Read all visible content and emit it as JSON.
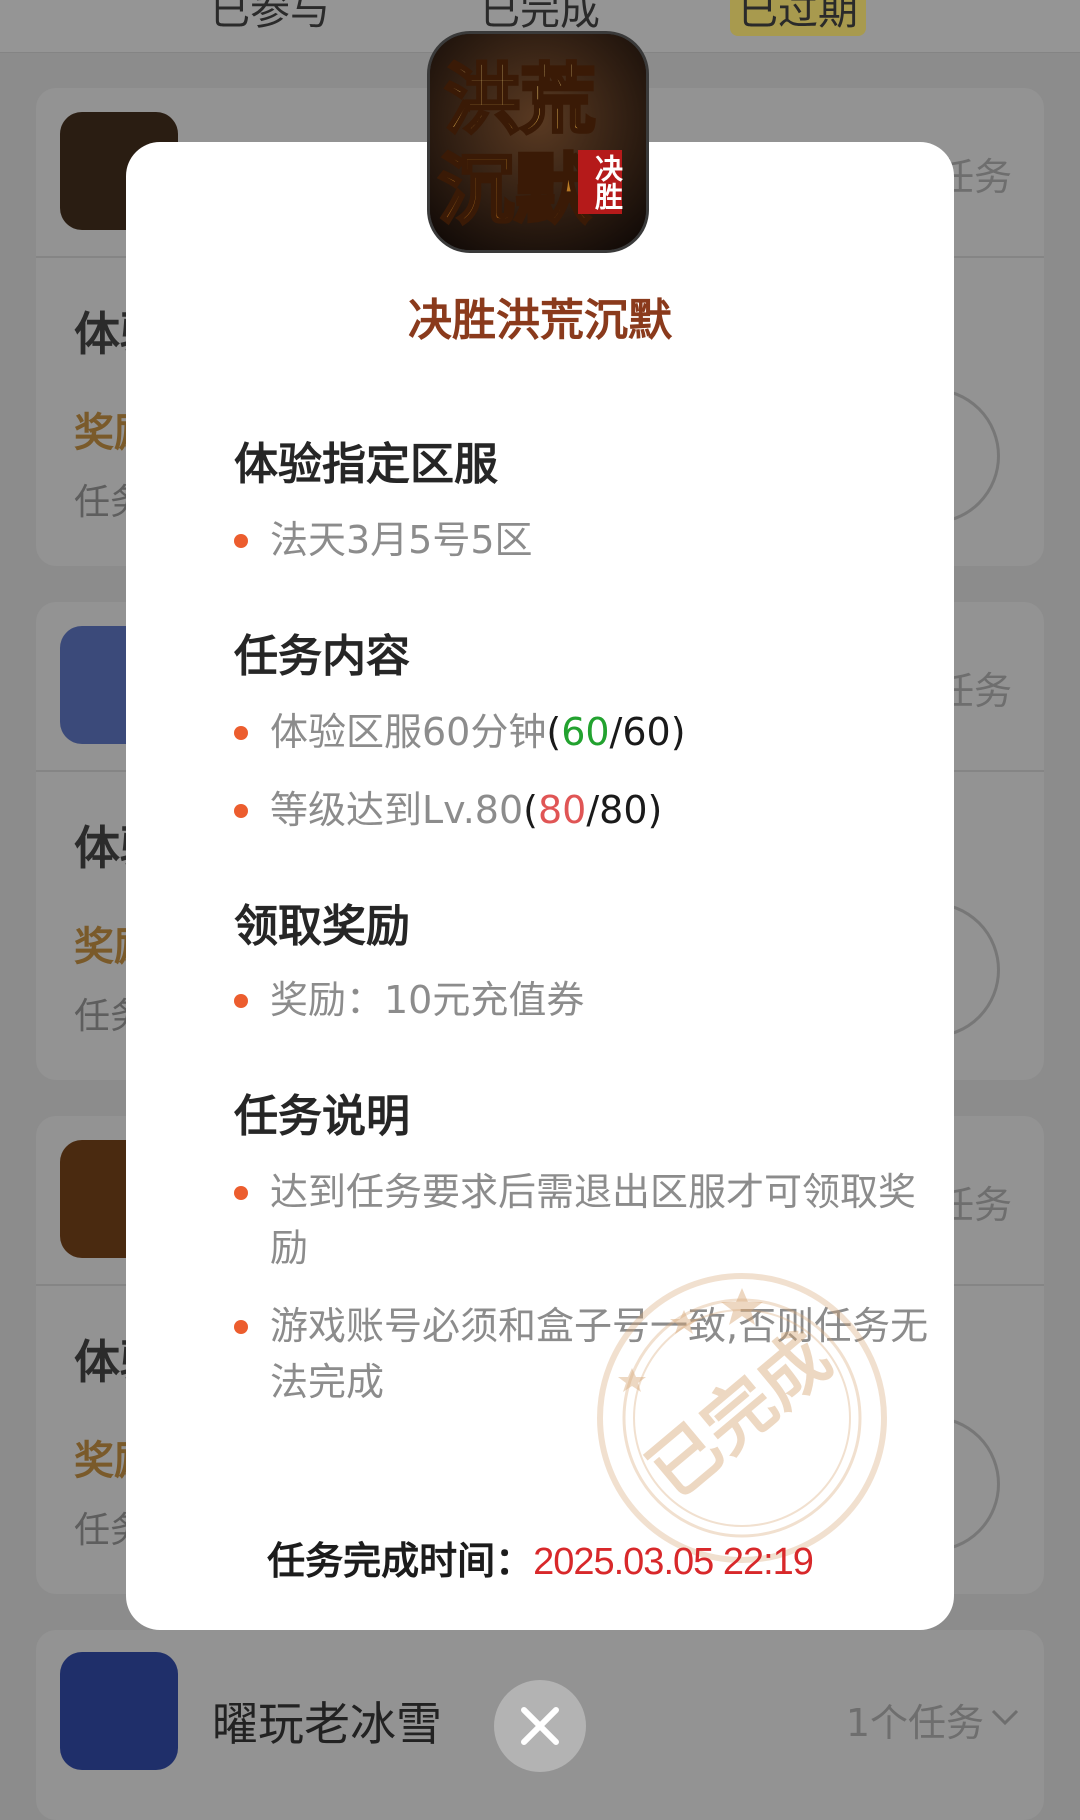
{
  "background": {
    "tabs": [
      "已参与",
      "已完成",
      "已过期"
    ],
    "cards": [
      {
        "count": "任务",
        "task_title": "体验",
        "reward": "奖励",
        "info": "任务"
      },
      {
        "count": "任务",
        "task_title": "体验",
        "reward": "奖励",
        "info": "任务"
      },
      {
        "count": "任务",
        "task_title": "体验",
        "reward": "奖励",
        "info": "任务"
      }
    ],
    "bottom_card": {
      "name": "曜玩老冰雪",
      "count": "1个任务"
    }
  },
  "modal": {
    "icon_text_main": "洪荒沉默",
    "icon_text_badge": "决胜",
    "title": "决胜洪荒沉默",
    "sections": [
      {
        "heading": "体验指定区服",
        "items": [
          "法天3月5号5区"
        ]
      },
      {
        "heading": "任务内容",
        "items": [
          {
            "text": "体验区服60分钟",
            "open": "(",
            "progress": "60",
            "total": "/60)",
            "progress_color": "green"
          },
          {
            "text": "等级达到Lv.80",
            "open": "(",
            "progress": "80",
            "total": "/80)",
            "progress_color": "red"
          }
        ]
      },
      {
        "heading": "领取奖励",
        "items": [
          "奖励：10元充值券"
        ]
      },
      {
        "heading": "任务说明",
        "items": [
          "达到任务要求后需退出区服才可领取奖励",
          "游戏账号必须和盒子号一致,否则任务无法完成"
        ]
      }
    ],
    "stamp_text": "已完成",
    "finish_label": "任务完成时间：",
    "finish_time": "2025.03.05 22:19"
  },
  "colors": {
    "accent": "#ec5d2e",
    "title": "#8a3a1c",
    "time": "#d8282a",
    "green": "#22a22f",
    "red": "#e05555"
  },
  "icons": {
    "close": "close-icon",
    "chevron": "chevron-down-icon",
    "bullet": "bullet-dot-icon"
  }
}
